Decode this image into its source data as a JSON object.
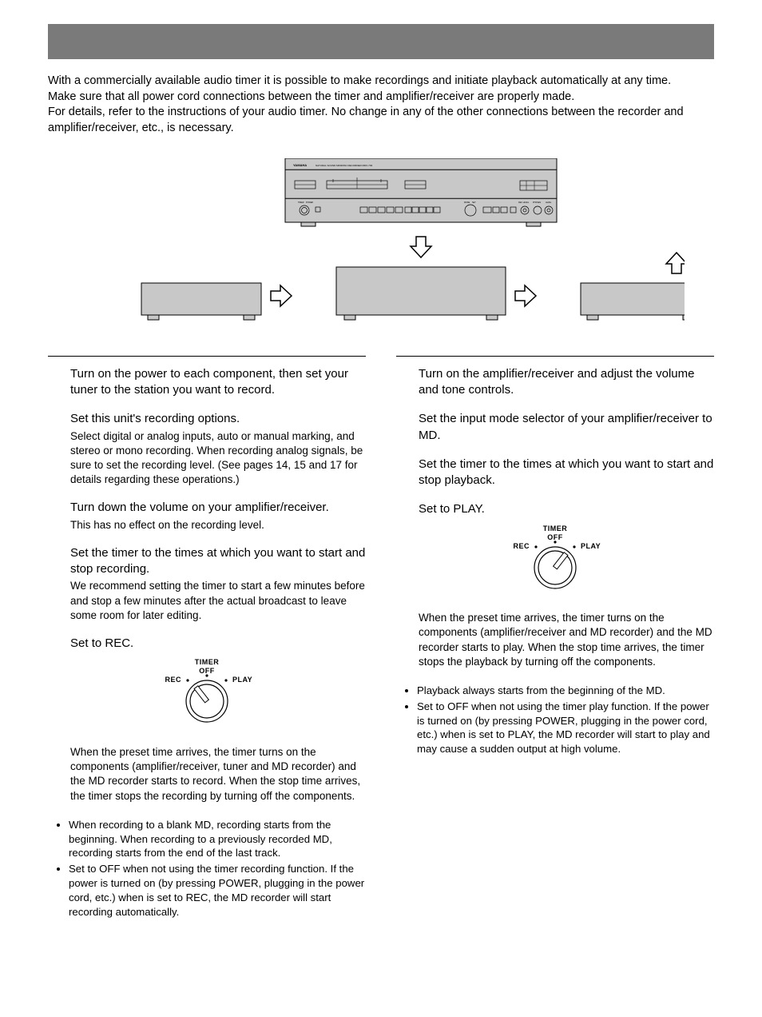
{
  "intro": {
    "p1": "With a commercially available audio timer it is possible to make recordings and initiate playback automatically at any time.",
    "p2": "Make sure that all power cord connections between the timer and amplifier/receiver are properly made.",
    "p3": "For details, refer to the instructions of your audio timer.  No change in any of the other connections between the recorder and amplifier/receiver, etc., is necessary."
  },
  "diagram": {
    "brand": "YAMAHA",
    "model": "NATURAL SOUND MINIDISC RECORDER  MDX-793"
  },
  "left": {
    "s1": "Turn on the power to each component, then set your tuner to the station you want to record.",
    "s2": "Set this unit's recording options.",
    "s2b": "Select digital or analog inputs, auto or manual marking, and stereo or mono recording. When recording analog signals, be sure to set the recording level. (See pages 14, 15 and 17 for details regarding these operations.)",
    "s3": "Turn down the volume on your amplifier/receiver.",
    "s3b": "This has no effect on the recording level.",
    "s4": "Set the timer to the times at which you want to start and stop recording.",
    "s4b": "We recommend setting the timer to start a few minutes before and stop a few minutes after the actual broadcast to leave some room for later editing.",
    "s5a": "Set ",
    "s5b": " to REC.",
    "result": "When the preset time arrives, the timer turns on the components (amplifier/receiver, tuner and MD recorder) and the MD recorder starts to record. When the stop time arrives, the timer stops the recording by turning off the components.",
    "n1": "When recording to a blank MD, recording starts from the beginning. When recording to a previously recorded MD, recording starts from the end of the last track.",
    "n2a": "Set ",
    "n2b": " to OFF when not using the timer recording function. If the power is turned on (by pressing POWER, plugging in the power cord, etc.) when ",
    "n2c": " is set to REC, the MD recorder will start recording automatically."
  },
  "right": {
    "s1": "Turn on the amplifier/receiver and adjust the volume and tone controls.",
    "s2": "Set the input mode selector of your amplifier/receiver to MD.",
    "s3": "Set the timer to the times at which you want to start and stop playback.",
    "s4a": "Set ",
    "s4b": " to PLAY.",
    "result": "When the preset time arrives, the timer turns on the components (amplifier/receiver and MD recorder) and the MD recorder starts to play. When the stop time arrives, the timer stops the playback by turning off the components.",
    "n1": "Playback always starts from the beginning of the MD.",
    "n2a": "Set ",
    "n2b": " to OFF when not using the timer play function. If the power is turned on (by pressing POWER, plugging in the power cord, etc.) when ",
    "n2c": " is set to PLAY, the MD recorder will start to play and may cause a sudden output at high volume."
  },
  "knob": {
    "title": "TIMER",
    "off": "OFF",
    "rec": "REC",
    "play": "PLAY"
  }
}
